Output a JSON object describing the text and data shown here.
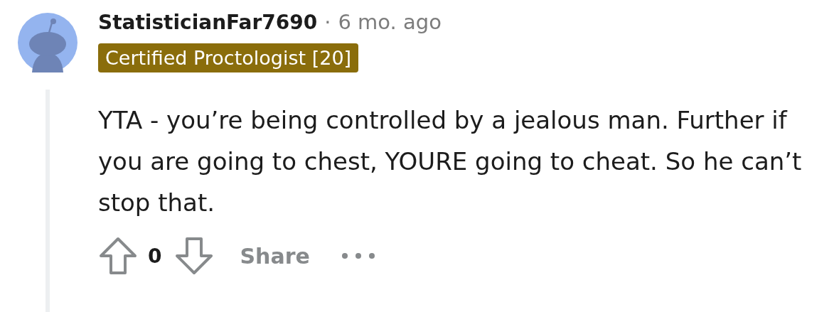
{
  "comment": {
    "author": "StatisticianFar7690",
    "separator": "·",
    "time": "6 mo. ago",
    "flair": "Certified Proctologist [20]",
    "body": "YTA - you’re being controlled by a jealous man. Further if you are going to chest, YOURE going to cheat. So he can’t stop that.",
    "score": "0",
    "share": "Share"
  }
}
